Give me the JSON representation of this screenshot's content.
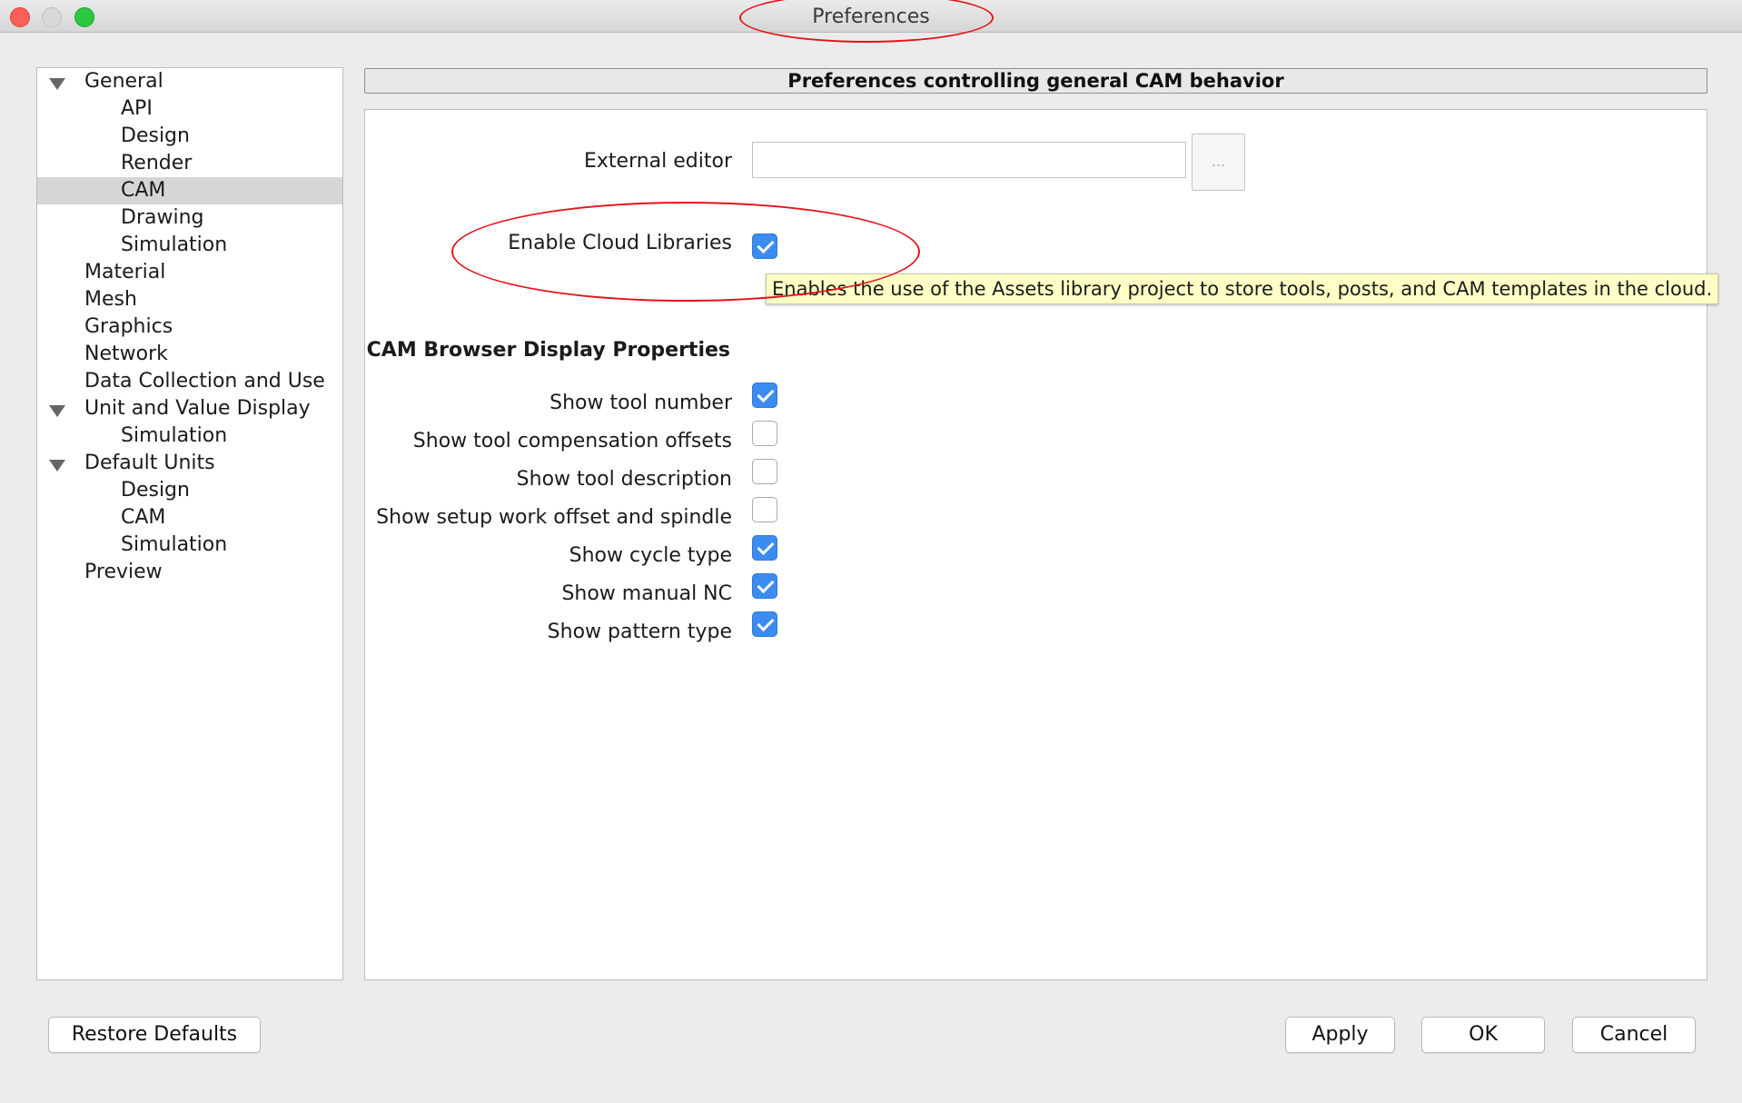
{
  "window": {
    "title": "Preferences"
  },
  "tree": {
    "items": [
      {
        "label": "General",
        "level": 0,
        "expanded": true
      },
      {
        "label": "API",
        "level": 1
      },
      {
        "label": "Design",
        "level": 1
      },
      {
        "label": "Render",
        "level": 1
      },
      {
        "label": "CAM",
        "level": 1,
        "selected": true
      },
      {
        "label": "Drawing",
        "level": 1
      },
      {
        "label": "Simulation",
        "level": 1
      },
      {
        "label": "Material",
        "level": 0
      },
      {
        "label": "Mesh",
        "level": 0
      },
      {
        "label": "Graphics",
        "level": 0
      },
      {
        "label": "Network",
        "level": 0
      },
      {
        "label": "Data Collection and Use",
        "level": 0
      },
      {
        "label": "Unit and Value Display",
        "level": 0,
        "expanded": true
      },
      {
        "label": "Simulation",
        "level": 1
      },
      {
        "label": "Default Units",
        "level": 0,
        "expanded": true
      },
      {
        "label": "Design",
        "level": 1
      },
      {
        "label": "CAM",
        "level": 1
      },
      {
        "label": "Simulation",
        "level": 1
      },
      {
        "label": "Preview",
        "level": 0
      }
    ]
  },
  "panel": {
    "header": "Preferences controlling general CAM behavior",
    "external_editor": {
      "label": "External editor",
      "value": "",
      "browse_label": "..."
    },
    "cloud_libraries": {
      "label": "Enable Cloud Libraries",
      "checked": true
    },
    "tooltip": "Enables the use of the Assets library project to store tools, posts, and CAM templates in the cloud.",
    "browser_section": {
      "title": "CAM Browser Display Properties",
      "options": [
        {
          "label": "Show tool number",
          "checked": true
        },
        {
          "label": "Show tool compensation offsets",
          "checked": false
        },
        {
          "label": "Show tool description",
          "checked": false
        },
        {
          "label": "Show setup work offset and spindle",
          "checked": false
        },
        {
          "label": "Show cycle type",
          "checked": true
        },
        {
          "label": "Show manual NC",
          "checked": true
        },
        {
          "label": "Show pattern type",
          "checked": true
        }
      ]
    }
  },
  "buttons": {
    "restore_defaults": "Restore Defaults",
    "apply": "Apply",
    "ok": "OK",
    "cancel": "Cancel"
  },
  "colors": {
    "checkbox_on": "#3b8cf0",
    "annotation": "#e4141b",
    "tooltip_bg": "#ffffc6"
  }
}
